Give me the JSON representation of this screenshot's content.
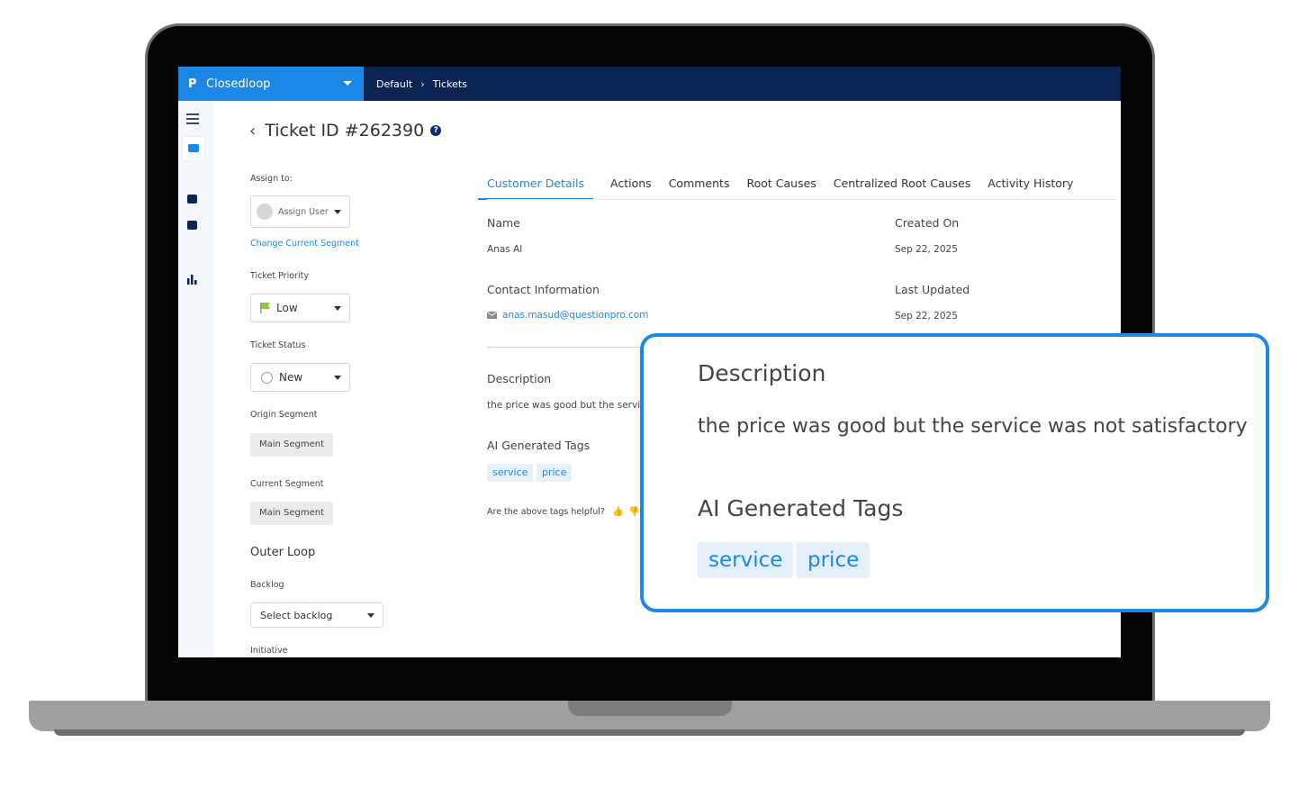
{
  "app": {
    "brand_logo": "P",
    "brand_name": "Closedloop",
    "breadcrumb": [
      "Default",
      "Tickets"
    ],
    "colors": {
      "topbar": "#0b2454",
      "brand": "#1b87e6",
      "accent": "#1b87e6",
      "callout_border": "#1e88e5"
    }
  },
  "ticket": {
    "title": "Ticket ID #262390",
    "help_icon": "?"
  },
  "left_panel": {
    "assign_label": "Assign to:",
    "assign_placeholder": "Assign User",
    "change_segment_link": "Change Current Segment",
    "priority_label": "Ticket Priority",
    "priority_value": "Low",
    "status_label": "Ticket Status",
    "status_value": "New",
    "origin_segment_label": "Origin Segment",
    "origin_segment_value": "Main Segment",
    "current_segment_label": "Current Segment",
    "current_segment_value": "Main Segment",
    "outer_loop_heading": "Outer Loop",
    "backlog_label": "Backlog",
    "backlog_placeholder": "Select backlog",
    "initiative_label": "Initiative"
  },
  "tabs": [
    {
      "label": "Customer Details",
      "active": true
    },
    {
      "label": "Actions"
    },
    {
      "label": "Comments"
    },
    {
      "label": "Root Causes"
    },
    {
      "label": "Centralized Root Causes"
    },
    {
      "label": "Activity History"
    }
  ],
  "details": {
    "name_label": "Name",
    "name_value": "Anas Al",
    "created_label": "Created On",
    "created_value": "Sep 22, 2025",
    "contact_label": "Contact Information",
    "email": "anas.masud@questionpro.com",
    "updated_label": "Last Updated",
    "updated_value": "Sep 22, 2025",
    "description_label": "Description",
    "description_truncated": "the price was good but the servic",
    "tags_label": "AI Generated Tags",
    "tags": [
      "service",
      "price"
    ],
    "helpful_question": "Are the above tags helpful?"
  },
  "callout": {
    "description_title": "Description",
    "description_text": "the price was good but the service was not satisfactory",
    "tags_title": "AI Generated Tags",
    "tags": [
      "service",
      "price"
    ]
  }
}
